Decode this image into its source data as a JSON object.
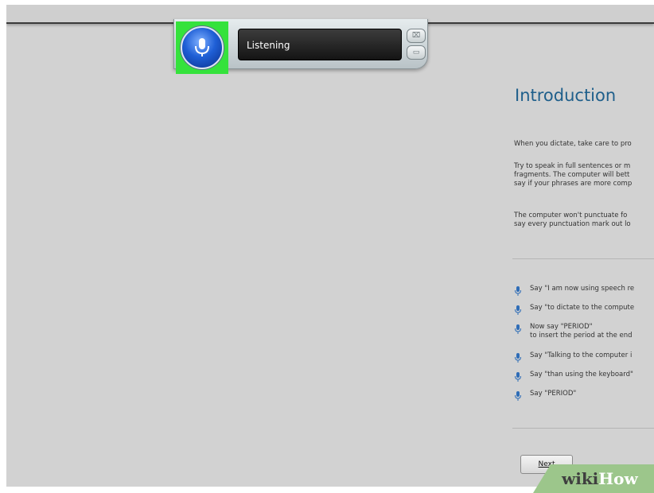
{
  "speech_bar": {
    "status_text": "Listening",
    "close_symbol": "⌧",
    "minimize_symbol": "▭",
    "icons": [
      "microphone-icon",
      "close-icon",
      "minimize-icon"
    ],
    "accent_color": "#35e23c"
  },
  "tutorial": {
    "title": "Introduction",
    "paragraphs": [
      "When you dictate, take care to pro",
      "Try to speak in full sentences or m\nfragments. The computer will bett\nsay if your phrases are more comp",
      "The computer won't punctuate fo\nsay every punctuation mark out lo"
    ],
    "instructions": [
      "Say \"I am now using speech re",
      "Say \"to dictate to the compute",
      "Now say \"PERIOD\"\nto insert the period at the end",
      "Say \"Talking to the computer i",
      "Say \"than using the keyboard\"",
      "Say \"PERIOD\""
    ],
    "next_button": "Next"
  },
  "watermark": {
    "wiki": "wiki",
    "how": "How"
  }
}
